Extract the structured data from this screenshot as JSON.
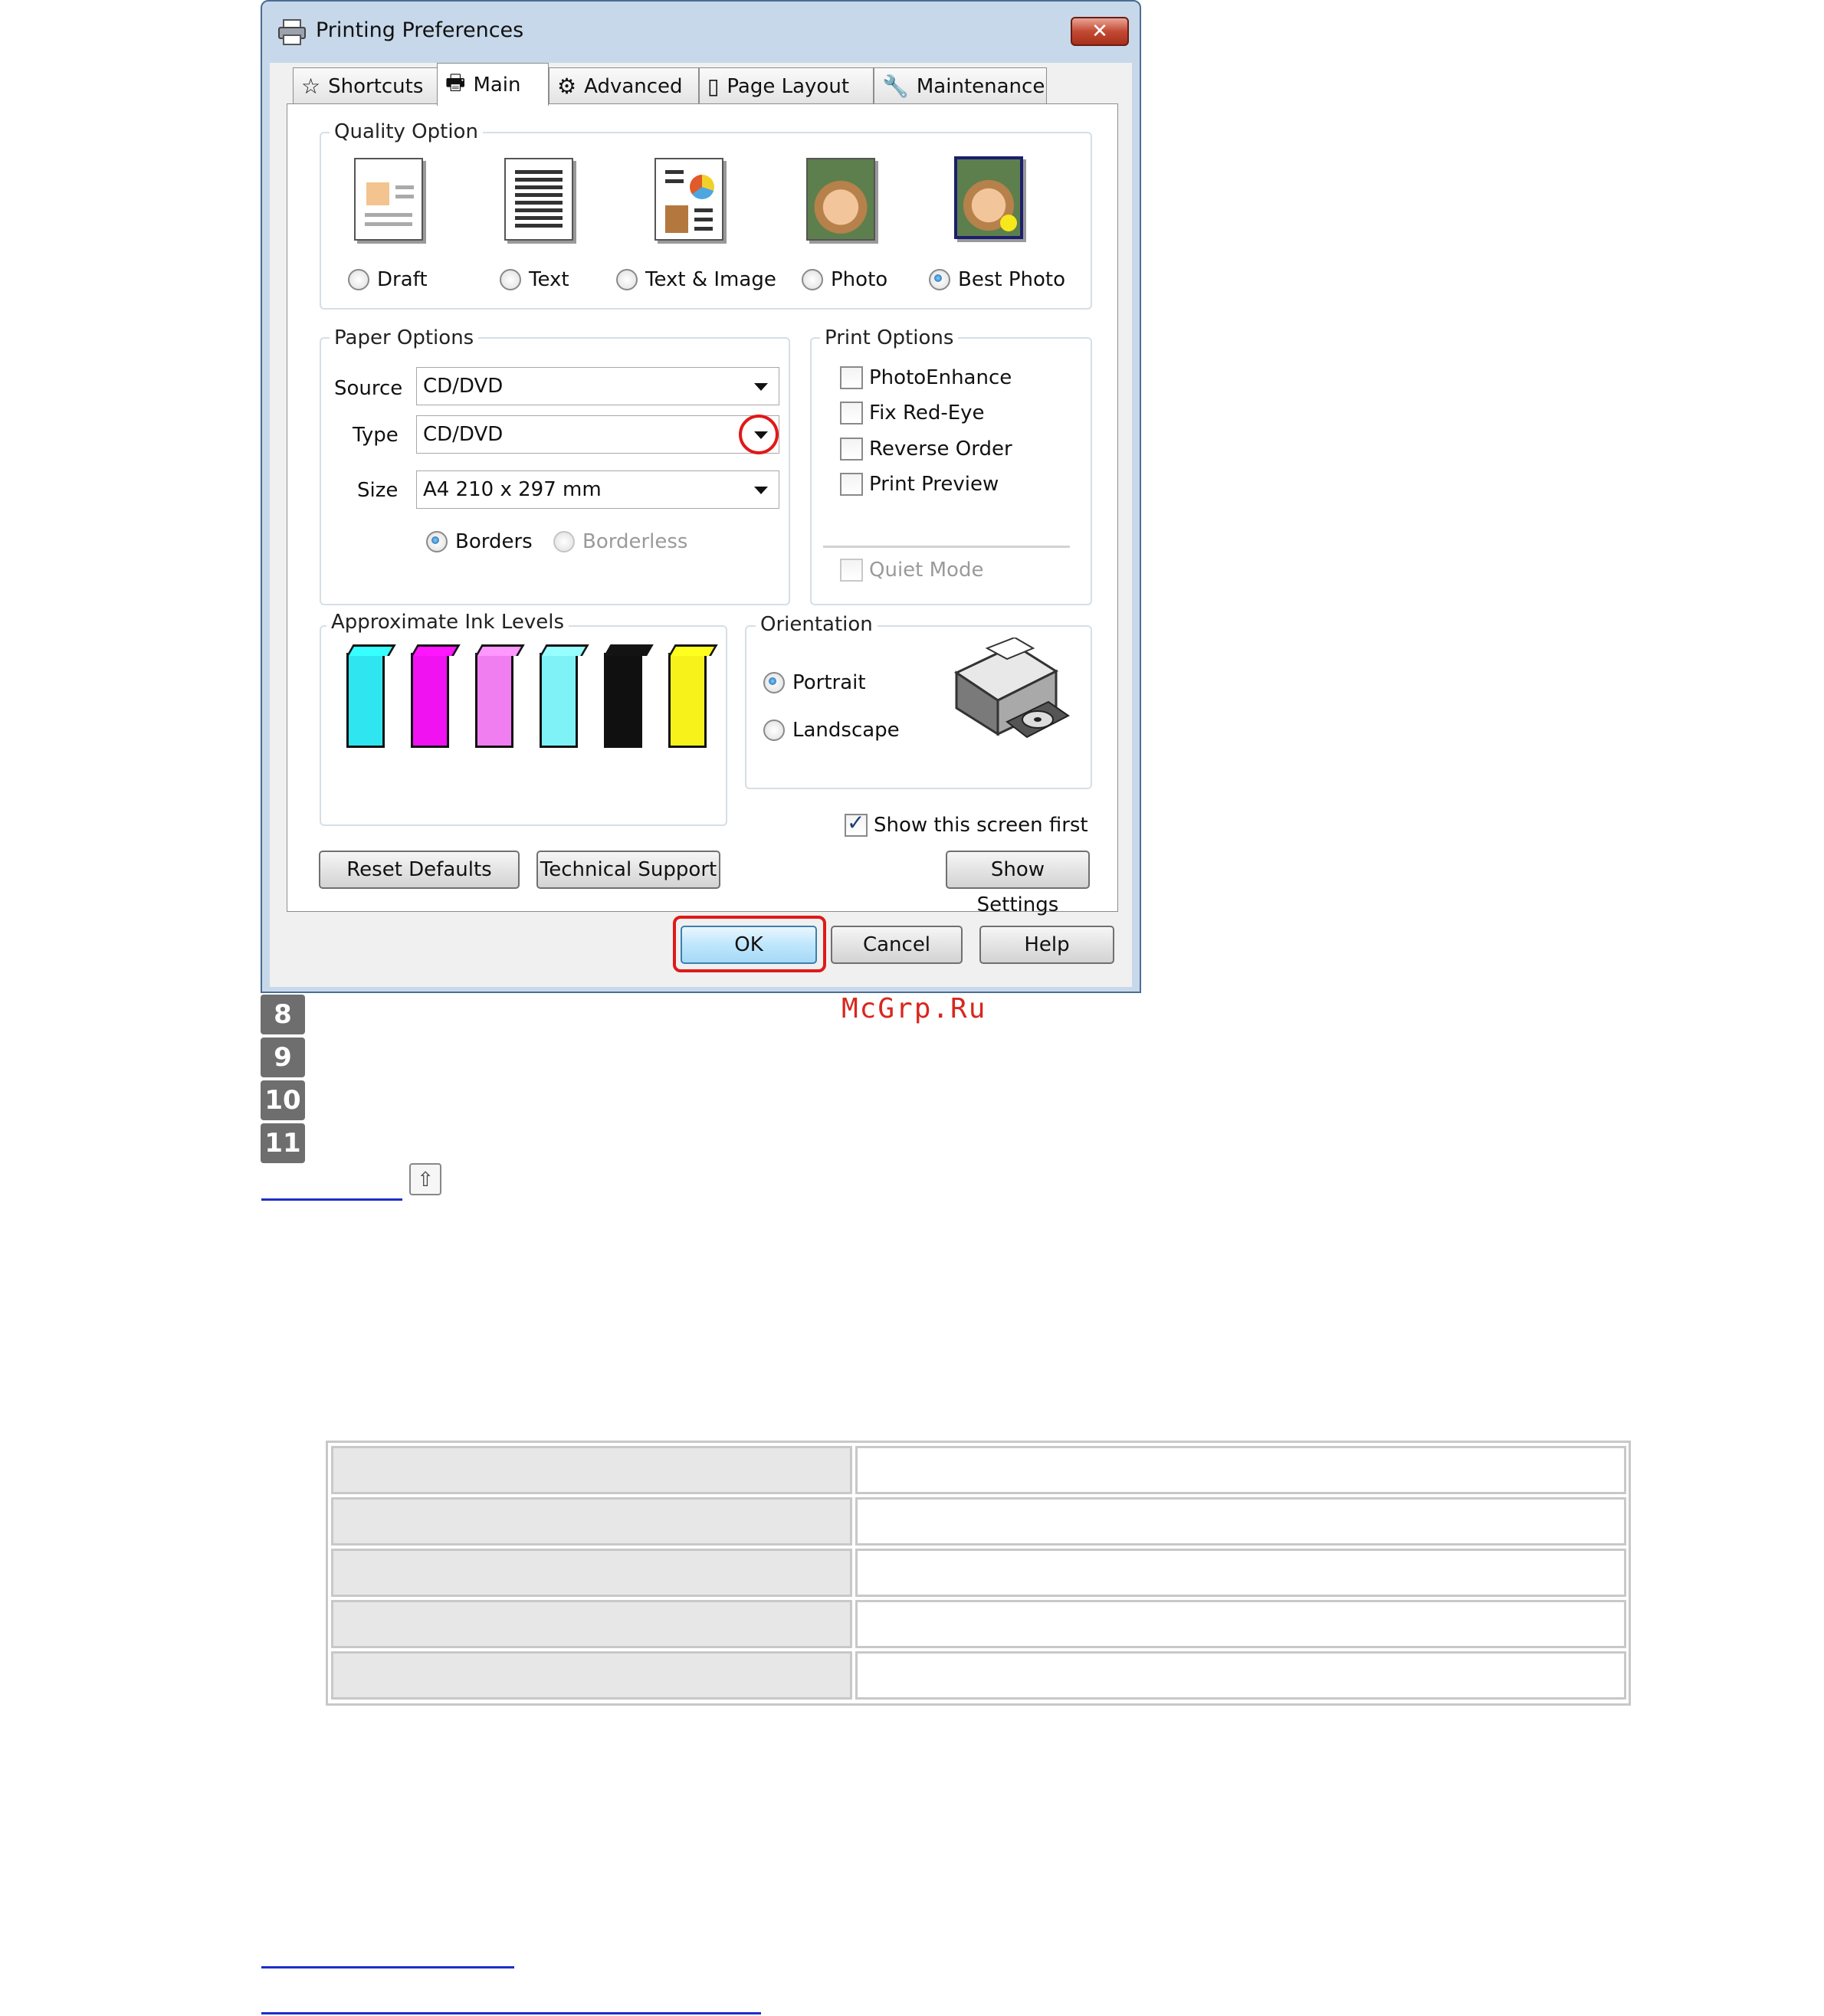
{
  "window": {
    "title": "Printing Preferences",
    "close_glyph": "✕"
  },
  "tabs": [
    {
      "label": "Shortcuts",
      "icon": "star-icon"
    },
    {
      "label": "Main",
      "icon": "printer-icon"
    },
    {
      "label": "Advanced",
      "icon": "advanced-settings-icon"
    },
    {
      "label": "Page Layout",
      "icon": "page-layout-icon"
    },
    {
      "label": "Maintenance",
      "icon": "wrench-icon"
    }
  ],
  "quality": {
    "label": "Quality Option",
    "options": [
      {
        "label": "Draft",
        "selected": false
      },
      {
        "label": "Text",
        "selected": false
      },
      {
        "label": "Text & Image",
        "selected": false
      },
      {
        "label": "Photo",
        "selected": false
      },
      {
        "label": "Best Photo",
        "selected": true
      }
    ]
  },
  "paper": {
    "label": "Paper Options",
    "source_label": "Source",
    "source_value": "CD/DVD",
    "type_label": "Type",
    "type_value": "CD/DVD",
    "size_label": "Size",
    "size_value": "A4 210 x 297 mm",
    "borders_label": "Borders",
    "borderless_label": "Borderless",
    "borders_selected": true
  },
  "print_options": {
    "label": "Print Options",
    "items": [
      {
        "label": "PhotoEnhance",
        "checked": false
      },
      {
        "label": "Fix Red-Eye",
        "checked": false
      },
      {
        "label": "Reverse Order",
        "checked": false
      },
      {
        "label": "Print Preview",
        "checked": false
      }
    ],
    "quiet_mode_label": "Quiet Mode"
  },
  "ink": {
    "label": "Approximate Ink Levels",
    "colors": [
      "#2fe6f0",
      "#f012f0",
      "#f07ef0",
      "#7ef2f6",
      "#101010",
      "#f6f21a"
    ]
  },
  "orientation": {
    "label": "Orientation",
    "portrait_label": "Portrait",
    "landscape_label": "Landscape",
    "portrait_selected": true
  },
  "show_first_label": "Show this screen first",
  "buttons": {
    "reset": "Reset Defaults",
    "support": "Technical Support",
    "show_settings": "Show Settings",
    "ok": "OK",
    "cancel": "Cancel",
    "help": "Help"
  },
  "steps": [
    "8",
    "9",
    "10",
    "11"
  ],
  "watermark": "McGrp.Ru",
  "top_icon": "up-arrow-icon",
  "highlight_color": "#e01919"
}
